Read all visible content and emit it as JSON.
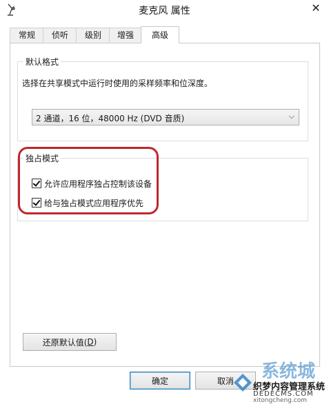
{
  "window": {
    "title": "麦克风 属性",
    "close_glyph": "✕"
  },
  "tabs": [
    {
      "label": "常规",
      "active": false
    },
    {
      "label": "侦听",
      "active": false
    },
    {
      "label": "级别",
      "active": false
    },
    {
      "label": "增强",
      "active": false
    },
    {
      "label": "高级",
      "active": true
    }
  ],
  "default_format": {
    "legend": "默认格式",
    "description": "选择在共享模式中运行时使用的采样频率和位深度。",
    "selected_value": "2 通道，16 位，48000 Hz (DVD 音质)"
  },
  "exclusive_mode": {
    "legend": "独占模式",
    "options": [
      {
        "label": "允许应用程序独占控制该设备",
        "checked": true
      },
      {
        "label": "给与独占模式应用程序优先",
        "checked": true
      }
    ]
  },
  "buttons": {
    "restore_default_prefix": "还原默认值(",
    "restore_default_key": "D",
    "restore_default_suffix": ")",
    "ok": "确定",
    "cancel": "取消"
  },
  "icons": {
    "title": "microphone-icon",
    "close": "close-icon",
    "dropdown": "chevron-down-icon"
  },
  "colors": {
    "annotation": "#c0262b",
    "primary_border": "#3c7fb1"
  },
  "watermark": {
    "big_text": "系统城",
    "line1": "织梦内容管理系统",
    "line2": "DEDECMS.COM",
    "line3": "xitongcheng.com"
  }
}
